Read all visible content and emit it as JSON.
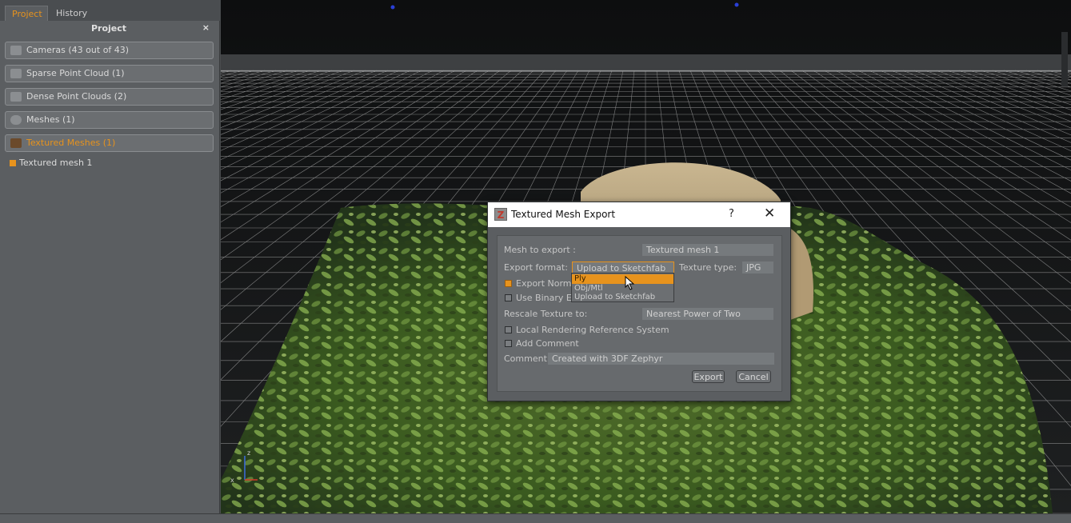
{
  "left_panel": {
    "tabs": [
      {
        "label": "Project",
        "active": true
      },
      {
        "label": "History",
        "active": false
      }
    ],
    "header": "Project",
    "close_glyph": "×",
    "sections": [
      {
        "label": "Cameras (43 out of 43)",
        "icon": "camera-icon"
      },
      {
        "label": "Sparse Point Cloud (1)",
        "icon": "sparse-cloud-icon"
      },
      {
        "label": "Dense Point Clouds (2)",
        "icon": "dense-cloud-icon"
      },
      {
        "label": "Meshes (1)",
        "icon": "mesh-icon"
      },
      {
        "label": "Textured Meshes (1)",
        "icon": "textured-mesh-icon",
        "active": true
      }
    ],
    "tree_item": "Textured mesh 1"
  },
  "dialog": {
    "title": "Textured Mesh Export",
    "help_glyph": "?",
    "close_glyph": "✕",
    "mesh_label": "Mesh to export :",
    "mesh_value": "Textured mesh 1",
    "format_label": "Export format:",
    "format_value": "Upload to Sketchfab",
    "texture_label": "Texture type:",
    "texture_value": "JPG",
    "export_normals_label": "Export Norma",
    "use_binary_label": "Use Binary En",
    "rescale_label": "Rescale Texture to:",
    "rescale_value": "Nearest Power of Two",
    "local_ref_label": "Local Rendering Reference System",
    "add_comment_label": "Add Comment",
    "comment_label": "Comment",
    "comment_value": "Created with 3DF Zephyr",
    "export_button": "Export",
    "cancel_button": "Cancel",
    "dropdown_options": [
      "Ply",
      "Obj/Mtl",
      "Upload to Sketchfab"
    ],
    "dropdown_selected": "Ply"
  },
  "viewport": {
    "axis_labels": {
      "z": "z",
      "x": "x"
    }
  },
  "colors": {
    "accent": "#e7931d",
    "panel_bg": "#5b5e61",
    "viewport_bg": "#121314"
  }
}
